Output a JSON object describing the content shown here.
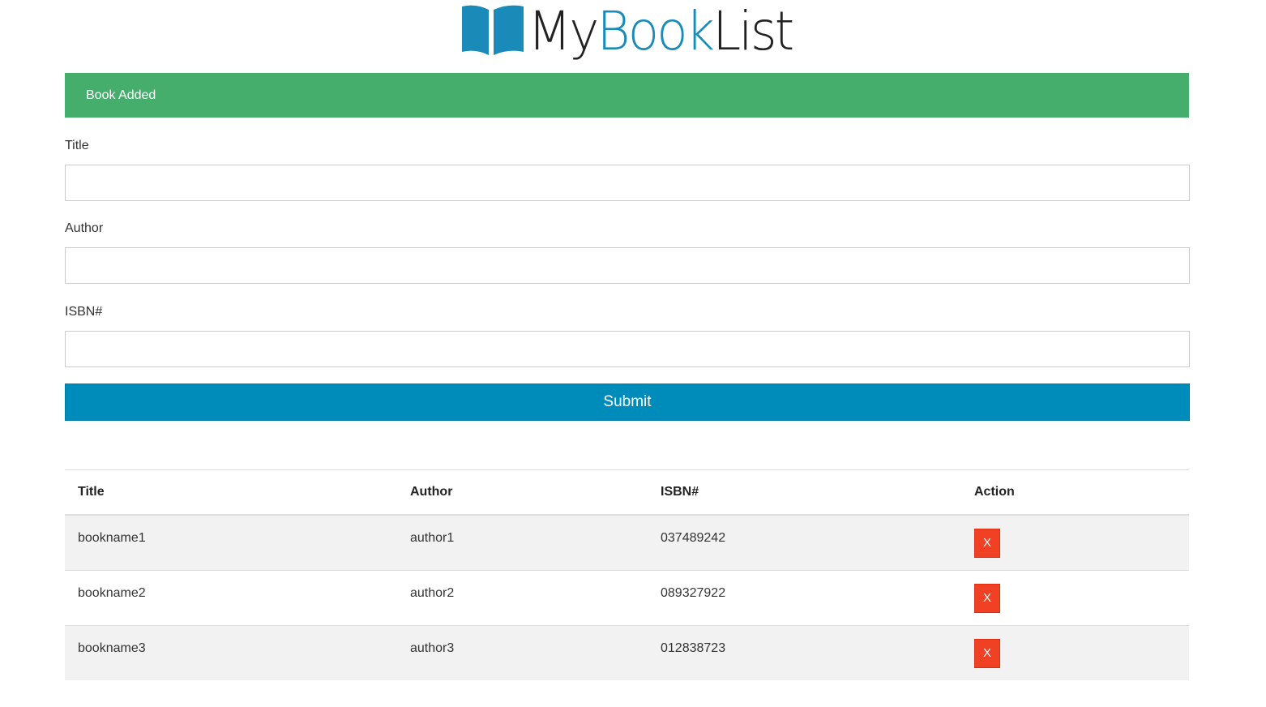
{
  "brand": {
    "name_part1": "My",
    "name_part2": "Book",
    "name_part3": "List",
    "accent_color": "#1a8bb8",
    "icon": "open-book-icon"
  },
  "alert": {
    "message": "Book Added",
    "color": "#46ae6d"
  },
  "form": {
    "title_label": "Title",
    "title_value": "",
    "author_label": "Author",
    "author_value": "",
    "isbn_label": "ISBN#",
    "isbn_value": "",
    "submit_label": "Submit",
    "submit_color": "#008cbb"
  },
  "table": {
    "headers": [
      "Title",
      "Author",
      "ISBN#",
      "Action"
    ],
    "rows": [
      {
        "title": "bookname1",
        "author": "author1",
        "isbn": "037489242",
        "action": "X"
      },
      {
        "title": "bookname2",
        "author": "author2",
        "isbn": "089327922",
        "action": "X"
      },
      {
        "title": "bookname3",
        "author": "author3",
        "isbn": "012838723",
        "action": "X"
      }
    ],
    "delete_color": "#f04124"
  }
}
